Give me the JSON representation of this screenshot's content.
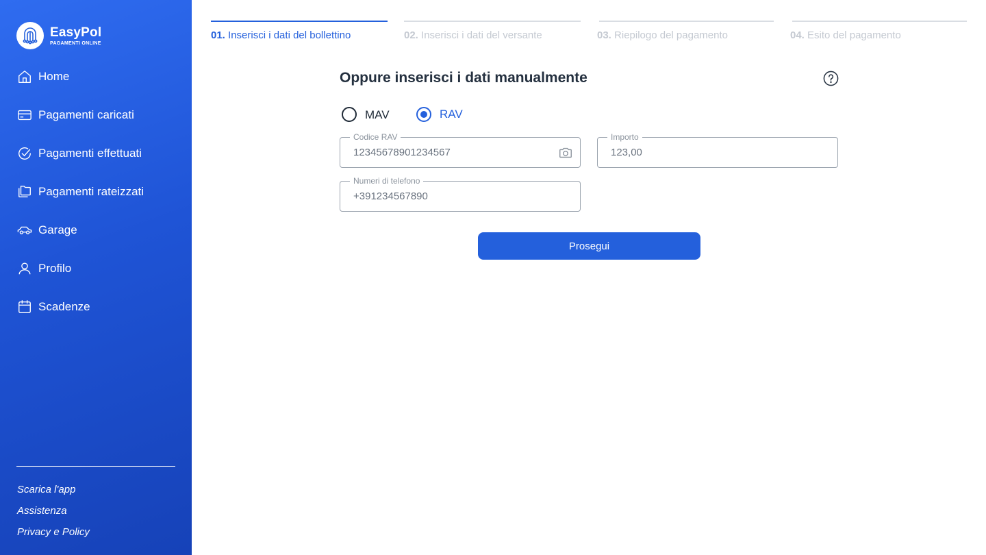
{
  "brand": {
    "name": "EasyPol",
    "subtitle": "PAGAMENTI ONLINE",
    "logo_icon": "pipe-bell-icon"
  },
  "colors": {
    "sidebar_top": "#2f6cf0",
    "sidebar_bottom": "#1642b8",
    "accent": "#2460dc",
    "inactive_step": "#c4c9d1"
  },
  "sidebar": {
    "items": [
      {
        "label": "Home",
        "icon": "home-icon"
      },
      {
        "label": "Pagamenti caricati",
        "icon": "credit-card-icon"
      },
      {
        "label": "Pagamenti effettuati",
        "icon": "check-circle-icon"
      },
      {
        "label": "Pagamenti rateizzati",
        "icon": "folders-icon"
      },
      {
        "label": "Garage",
        "icon": "car-icon"
      },
      {
        "label": "Profilo",
        "icon": "user-icon"
      },
      {
        "label": "Scadenze",
        "icon": "calendar-icon"
      }
    ],
    "footer": [
      "Scarica l'app",
      "Assistenza",
      "Privacy e Policy"
    ]
  },
  "stepper": [
    {
      "num": "01.",
      "label": "Inserisci i dati del bollettino",
      "active": true
    },
    {
      "num": "02.",
      "label": "Inserisci i dati del versante",
      "active": false
    },
    {
      "num": "03.",
      "label": "Riepilogo del pagamento",
      "active": false
    },
    {
      "num": "04.",
      "label": "Esito del pagamento",
      "active": false
    }
  ],
  "form": {
    "title": "Oppure inserisci i dati manualmente",
    "help_icon": "question-circle-icon",
    "options": [
      {
        "label": "MAV",
        "selected": false
      },
      {
        "label": "RAV",
        "selected": true
      }
    ],
    "fields": {
      "codice": {
        "legend": "Codice RAV",
        "value": "12345678901234567",
        "icon": "camera-icon"
      },
      "importo": {
        "legend": "Importo",
        "value": "123,00"
      },
      "telefono": {
        "legend": "Numeri di telefono",
        "value": "+391234567890"
      }
    },
    "submit_label": "Prosegui"
  }
}
